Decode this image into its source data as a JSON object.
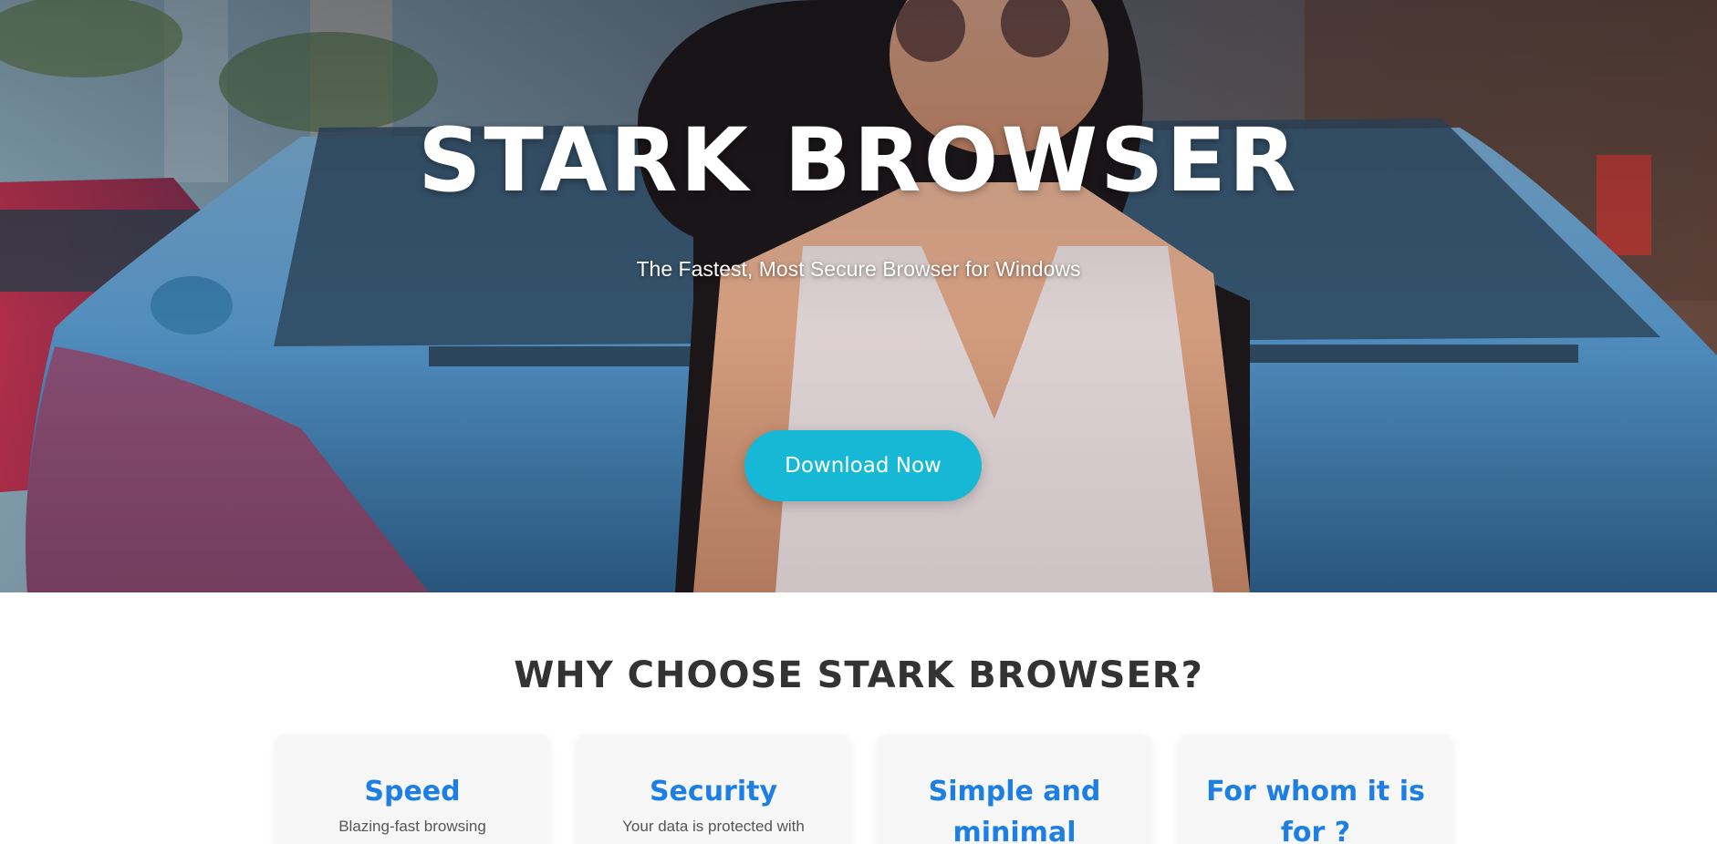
{
  "hero": {
    "title": "STARK BROWSER",
    "subtitle": "The Fastest, Most Secure Browser for Windows",
    "download_label": "Download Now"
  },
  "why": {
    "title": "WHY CHOOSE STARK BROWSER?"
  },
  "cards": [
    {
      "title": "Speed",
      "text": "Blazing-fast browsing"
    },
    {
      "title": "Security",
      "text": "Your data is protected with"
    },
    {
      "title": "Simple and minimal",
      "text": ""
    },
    {
      "title": "For whom it is for ?",
      "text": ""
    }
  ],
  "colors": {
    "accent_button": "#17b8d6",
    "card_title": "#1d7fe4",
    "heading": "#333333",
    "card_bg": "#f7f7f7"
  }
}
